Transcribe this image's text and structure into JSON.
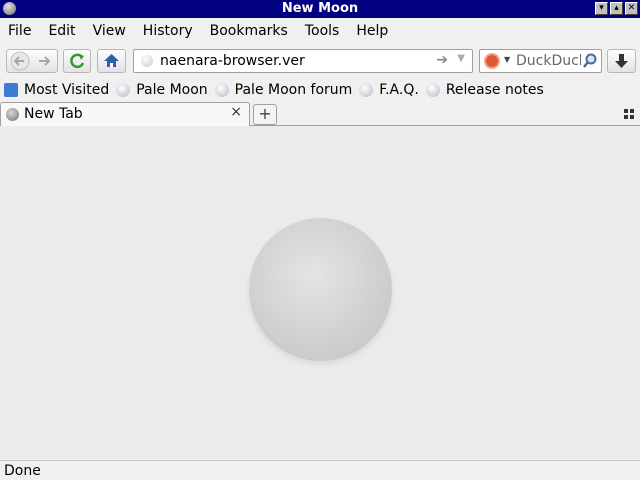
{
  "window": {
    "title": "New Moon"
  },
  "menubar": {
    "items": [
      "File",
      "Edit",
      "View",
      "History",
      "Bookmarks",
      "Tools",
      "Help"
    ]
  },
  "navbar": {
    "url": "naenara-browser.ver",
    "search_placeholder": "DuckDuck"
  },
  "bookmarks": [
    "Most Visited",
    "Pale Moon",
    "Pale Moon forum",
    "F.A.Q.",
    "Release notes"
  ],
  "tabs": [
    {
      "label": "New Tab",
      "close": "×"
    }
  ],
  "newtab_label": "+",
  "status": {
    "text": "Done"
  },
  "colors": {
    "titlebar": "#000080",
    "content_bg": "#ebebeb",
    "ddg": "#de5833"
  },
  "icons": [
    "back-icon",
    "forward-icon",
    "reload-icon",
    "home-icon",
    "download-icon",
    "search-magnifier-icon",
    "duckduckgo-icon"
  ]
}
